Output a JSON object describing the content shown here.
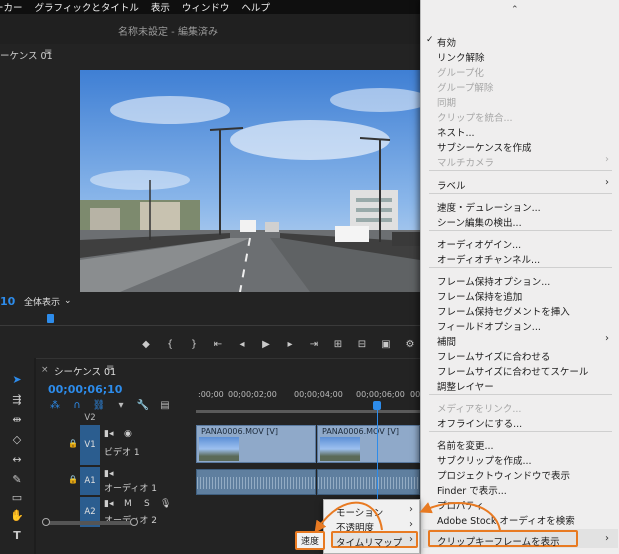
{
  "menubar": {
    "items": [
      "ーカー",
      "グラフィックとタイトル",
      "表示",
      "ウィンドウ",
      "ヘルプ"
    ]
  },
  "document": {
    "title": "名称未設定 - 編集済み"
  },
  "program_monitor": {
    "sequence_tab": "ーケンス 01",
    "menu_glyph": "≡",
    "timecode": "10",
    "fit_label": "全体表示"
  },
  "timeline": {
    "close_glyph": "×",
    "tab_label": "シーケンス 01",
    "menu_glyph": "≡",
    "timecode": "00;00;06;10",
    "ruler_ticks": [
      ":00;00",
      "00;00;02;00",
      "00;00;04;00",
      "00;00;06;00",
      "00;00;0"
    ],
    "tracks": {
      "v2": "V2",
      "v1": "V1",
      "v1_name": "ビデオ 1",
      "a1": "A1",
      "a1_name": "オーディオ 1",
      "a2": "A2",
      "a2_name": "オーディオ 2",
      "mute": "M",
      "solo": "S"
    },
    "clips": [
      {
        "name": "PANA0006.MOV [V]"
      },
      {
        "name": "PANA0006.MOV [V]"
      }
    ]
  },
  "context_menu": {
    "items": [
      {
        "label": "有効",
        "checked": true,
        "enabled": true
      },
      {
        "label": "リンク解除",
        "enabled": true
      },
      {
        "label": "グループ化",
        "enabled": false
      },
      {
        "label": "グループ解除",
        "enabled": false
      },
      {
        "label": "同期",
        "enabled": false
      },
      {
        "label": "クリップを統合...",
        "enabled": false
      },
      {
        "label": "ネスト...",
        "enabled": true
      },
      {
        "label": "サブシーケンスを作成",
        "enabled": true
      },
      {
        "label": "マルチカメラ",
        "enabled": false,
        "submenu": true
      },
      {
        "label": "ラベル",
        "enabled": true,
        "submenu": true
      },
      {
        "label": "速度・デュレーション...",
        "enabled": true
      },
      {
        "label": "シーン編集の検出...",
        "enabled": true
      },
      {
        "label": "オーディオゲイン...",
        "enabled": true
      },
      {
        "label": "オーディオチャンネル...",
        "enabled": true
      },
      {
        "label": "フレーム保持オプション...",
        "enabled": true
      },
      {
        "label": "フレーム保持を追加",
        "enabled": true
      },
      {
        "label": "フレーム保持セグメントを挿入",
        "enabled": true
      },
      {
        "label": "フィールドオプション...",
        "enabled": true
      },
      {
        "label": "補間",
        "enabled": true,
        "submenu": true
      },
      {
        "label": "フレームサイズに合わせる",
        "enabled": true
      },
      {
        "label": "フレームサイズに合わせてスケール",
        "enabled": true
      },
      {
        "label": "調整レイヤー",
        "enabled": true
      },
      {
        "label": "メディアをリンク...",
        "enabled": false
      },
      {
        "label": "オフラインにする...",
        "enabled": true
      },
      {
        "label": "名前を変更...",
        "enabled": true
      },
      {
        "label": "サブクリップを作成...",
        "enabled": true
      },
      {
        "label": "プロジェクトウィンドウで表示",
        "enabled": true
      },
      {
        "label": "Finder で表示...",
        "enabled": true
      },
      {
        "label": "プロパティ",
        "enabled": true
      },
      {
        "label": "Adobe Stock オーディオを検索",
        "enabled": true
      },
      {
        "label": "クリップキーフレームを表示",
        "enabled": true,
        "submenu": true,
        "highlighted": true
      }
    ]
  },
  "submenu": {
    "items": [
      {
        "label": "モーション"
      },
      {
        "label": "不透明度"
      },
      {
        "label": "タイムリマップ",
        "highlighted": true
      }
    ],
    "speed_label": "速度"
  },
  "colors": {
    "accent": "#2d8ceb",
    "highlight_outline": "#e87a22",
    "track_label": "#2b5d8f",
    "menu_bg": "#efeeee"
  }
}
